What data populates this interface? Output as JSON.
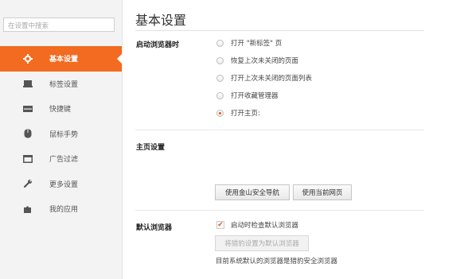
{
  "search": {
    "placeholder": "在设置中搜索"
  },
  "sidebar": {
    "items": [
      {
        "label": "基本设置",
        "icon": "gear-icon",
        "active": true
      },
      {
        "label": "标签设置",
        "icon": "tab-icon",
        "active": false
      },
      {
        "label": "快捷键",
        "icon": "keyboard-icon",
        "active": false
      },
      {
        "label": "鼠标手势",
        "icon": "mouse-icon",
        "active": false
      },
      {
        "label": "广告过滤",
        "icon": "window-icon",
        "active": false
      },
      {
        "label": "更多设置",
        "icon": "wrench-icon",
        "active": false
      },
      {
        "label": "我的应用",
        "icon": "puzzle-icon",
        "active": false
      }
    ]
  },
  "main": {
    "title": "基本设置",
    "startup": {
      "label": "启动浏览器时",
      "options": [
        {
          "label": "打开 \"新标签\" 页",
          "selected": false
        },
        {
          "label": "恢复上次未关闭的页面",
          "selected": false
        },
        {
          "label": "打开上次未关闭的页面列表",
          "selected": false
        },
        {
          "label": "打开收藏管理器",
          "selected": false
        },
        {
          "label": "打开主页:",
          "selected": true
        }
      ]
    },
    "homepage": {
      "label": "主页设置",
      "buttons": [
        "使用金山安全导航",
        "使用当前网页"
      ]
    },
    "default_browser": {
      "label": "默认浏览器",
      "check_label": "启动时检查默认浏览器",
      "checked": true,
      "button": "将猎豹设置为默认浏览器",
      "note": "目前系统默认的浏览器是猎豹安全浏览器"
    }
  },
  "colors": {
    "accent": "#f26b20",
    "sidebar_bg": "#f3f3f3"
  }
}
